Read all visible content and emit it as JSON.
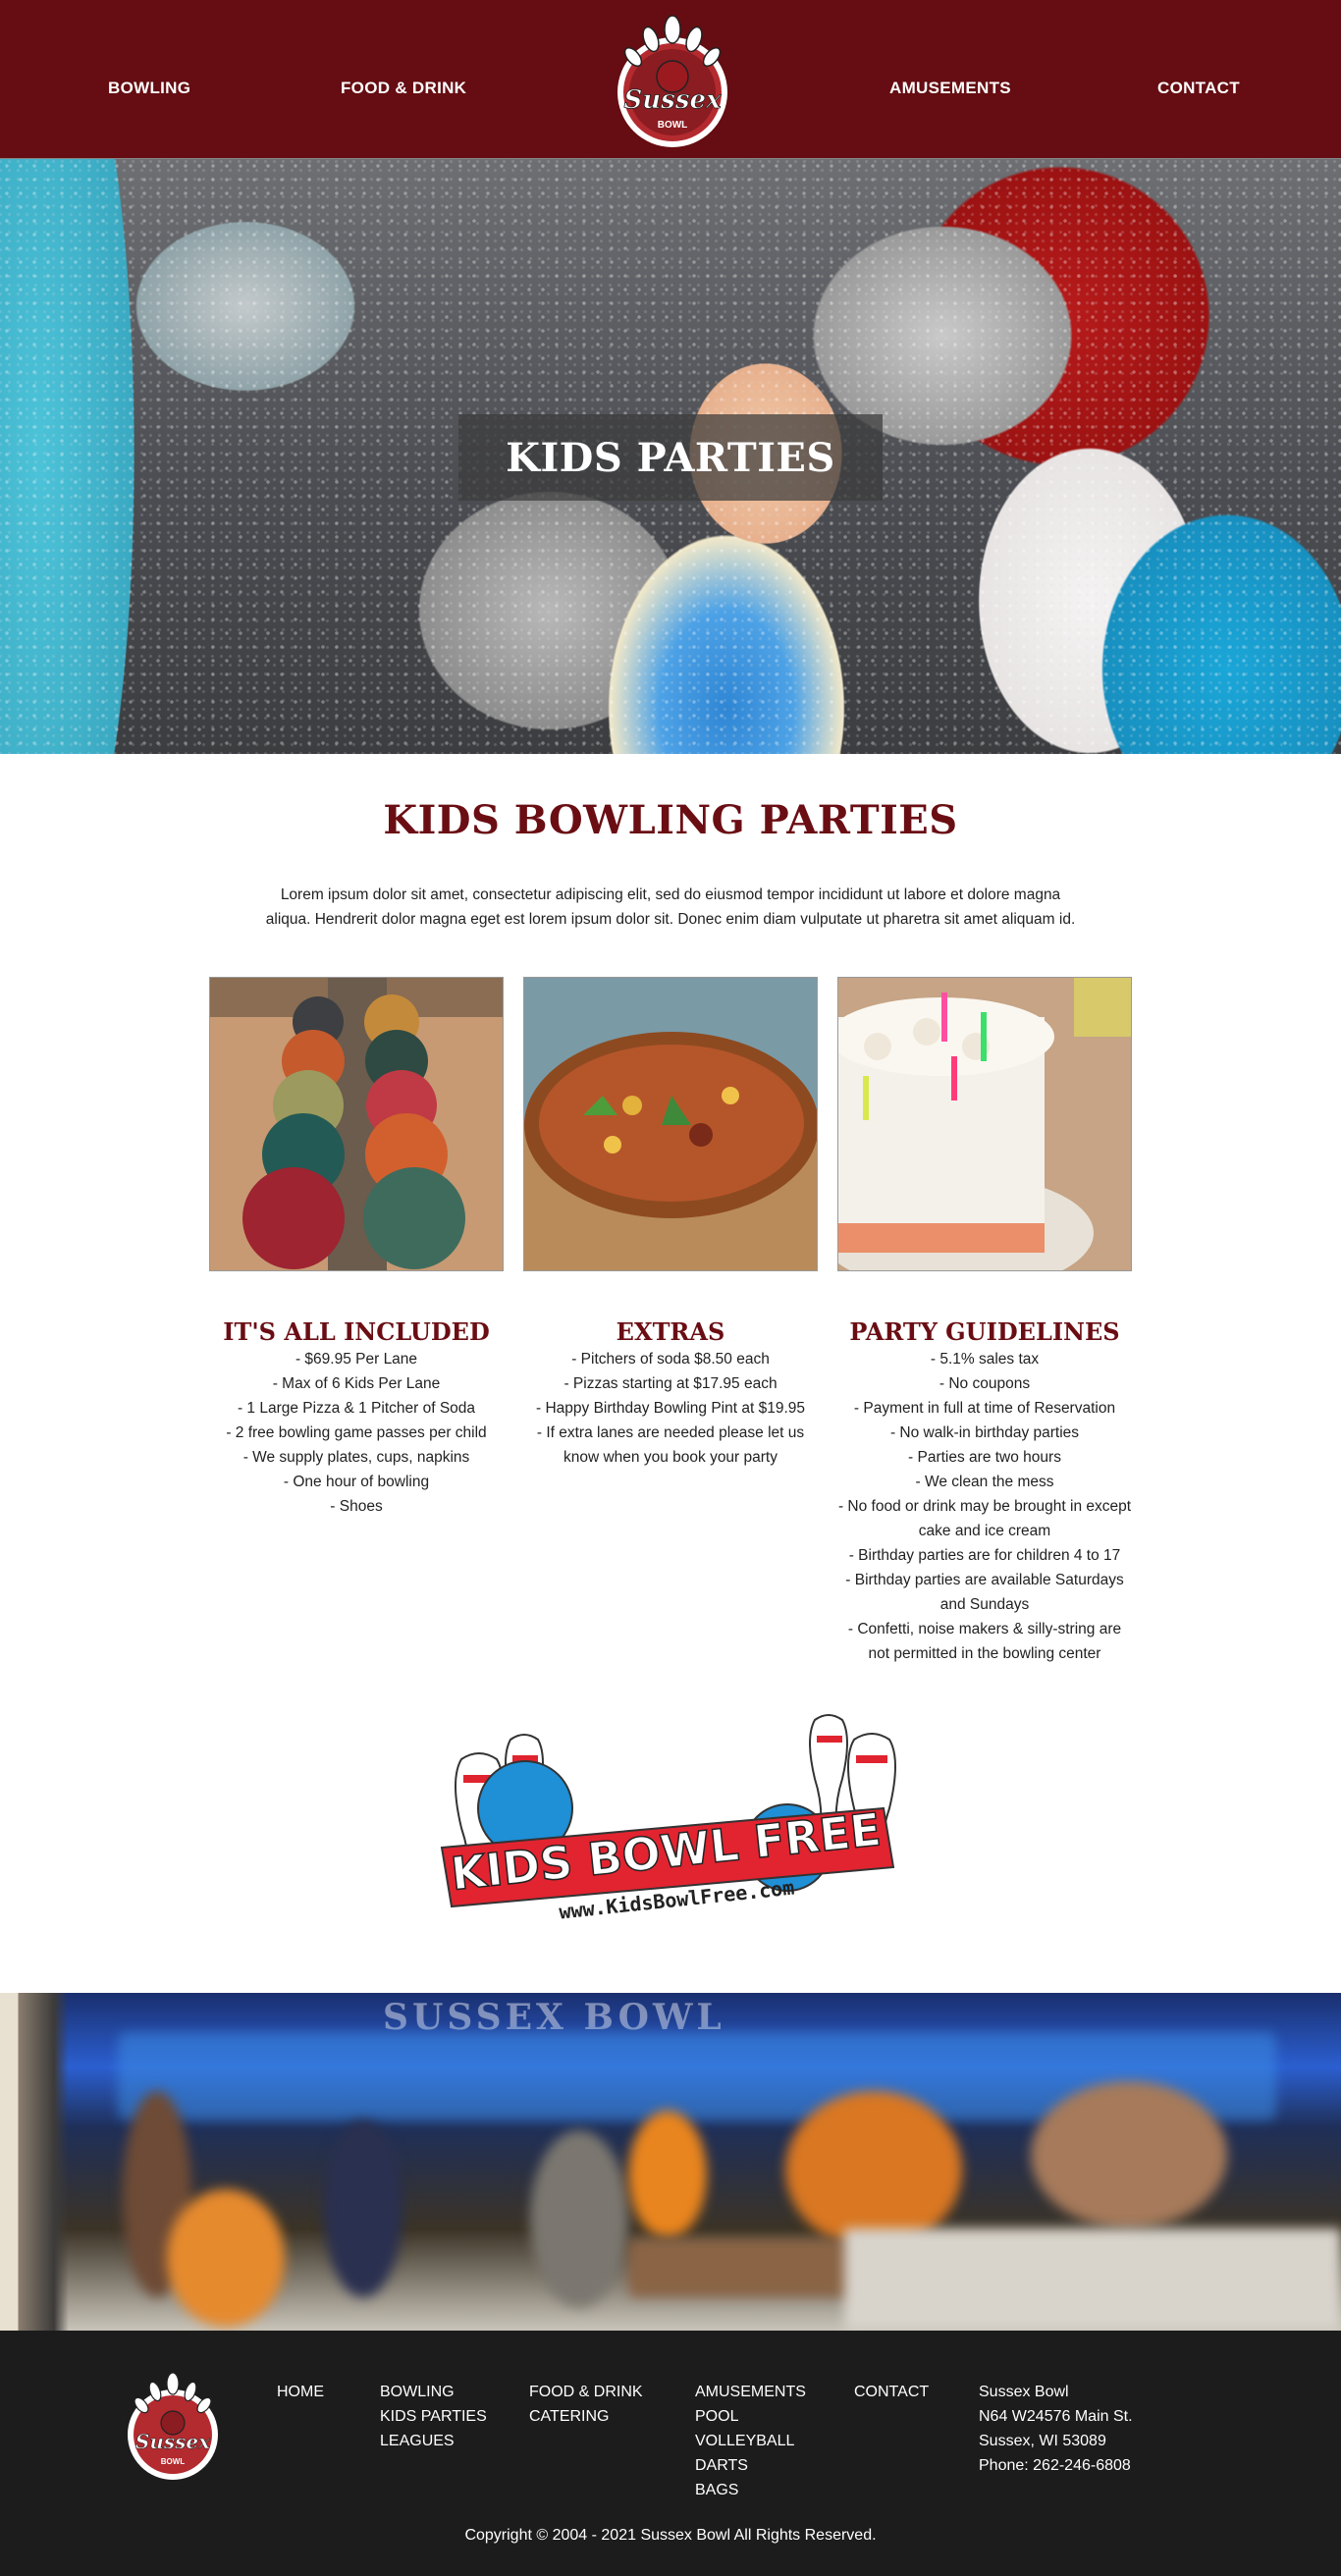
{
  "header": {
    "nav_left": [
      "BOWLING",
      "FOOD & DRINK"
    ],
    "nav_right": [
      "AMUSEMENTS",
      "CONTACT"
    ],
    "logo_text": "Sussex",
    "logo_subtext": "BOWL"
  },
  "hero": {
    "title": "KIDS PARTIES"
  },
  "main": {
    "title": "KIDS BOWLING PARTIES",
    "intro": "Lorem ipsum dolor sit amet, consectetur adipiscing elit, sed do eiusmod tempor incididunt ut labore et dolore magna aliqua. Hendrerit dolor magna eget est lorem ipsum dolor sit. Donec enim diam vulputate ut pharetra sit amet aliquam id."
  },
  "columns": [
    {
      "title": "IT'S ALL INCLUDED",
      "items": [
        "- $69.95 Per Lane",
        "- Max of 6 Kids Per Lane",
        "- 1 Large Pizza & 1 Pitcher of Soda",
        "- 2 free bowling game passes per child",
        "- We supply plates, cups, napkins",
        "- One hour of bowling",
        "- Shoes"
      ]
    },
    {
      "title": "EXTRAS",
      "items": [
        "- Pitchers of soda $8.50 each",
        "- Pizzas starting at $17.95 each",
        "- Happy Birthday Bowling Pint at $19.95",
        "- If extra lanes are needed please let us know when you book your party"
      ]
    },
    {
      "title": "PARTY GUIDELINES",
      "items": [
        "- 5.1% sales tax",
        "- No coupons",
        "- Payment in full at time of Reservation",
        "- No walk-in birthday parties",
        "- Parties are two hours",
        "- We clean the mess",
        "- No food or drink may be brought in except cake and ice cream",
        "- Birthday parties are for children 4 to 17",
        "- Birthday parties are available Saturdays and Sundays",
        "- Confetti, noise makers & silly-string are not permitted in the bowling center"
      ]
    }
  ],
  "kids_bowl_free": {
    "title": "KIDS BOWL FREE",
    "url": "www.KidsBowlFree.com"
  },
  "banner": {
    "sign_text": "SUSSEX BOWL"
  },
  "footer": {
    "col_home": [
      "HOME"
    ],
    "col_bowling": [
      "BOWLING",
      "KIDS PARTIES",
      "LEAGUES"
    ],
    "col_food": [
      "FOOD & DRINK",
      "CATERING"
    ],
    "col_amusements": [
      "AMUSEMENTS",
      "POOL",
      "VOLLEYBALL",
      "DARTS",
      "BAGS"
    ],
    "col_contact": [
      "CONTACT"
    ],
    "address": [
      "Sussex Bowl",
      "N64 W24576 Main St.",
      "Sussex, WI 53089",
      "Phone: 262-246-6808"
    ],
    "copyright": "Copyright © 2004 - 2021 Sussex Bowl All Rights Reserved."
  }
}
